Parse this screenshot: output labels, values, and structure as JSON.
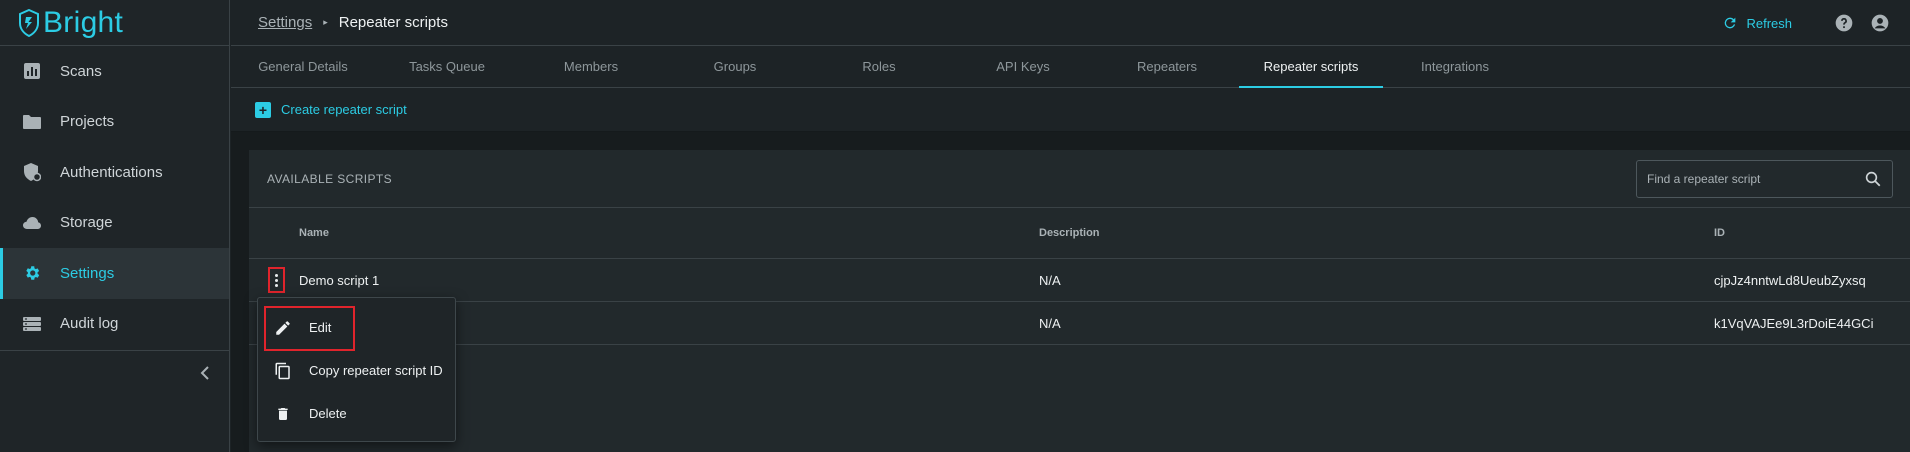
{
  "brand": {
    "name": "Bright",
    "accent": "#2ccce4",
    "highlight": "#e0242c"
  },
  "sidebar": {
    "items": [
      {
        "label": "Scans",
        "icon": "bar-chart-icon",
        "active": false
      },
      {
        "label": "Projects",
        "icon": "folder-icon",
        "active": false
      },
      {
        "label": "Authentications",
        "icon": "shield-lock-icon",
        "active": false
      },
      {
        "label": "Storage",
        "icon": "cloud-icon",
        "active": false
      },
      {
        "label": "Settings",
        "icon": "gear-icon",
        "active": true
      },
      {
        "label": "Audit log",
        "icon": "server-icon",
        "active": false
      }
    ]
  },
  "breadcrumb": {
    "parent": "Settings",
    "current": "Repeater scripts"
  },
  "header": {
    "refresh_label": "Refresh"
  },
  "tabs": [
    {
      "label": "General Details"
    },
    {
      "label": "Tasks Queue"
    },
    {
      "label": "Members"
    },
    {
      "label": "Groups"
    },
    {
      "label": "Roles"
    },
    {
      "label": "API Keys"
    },
    {
      "label": "Repeaters"
    },
    {
      "label": "Repeater scripts",
      "active": true
    },
    {
      "label": "Integrations"
    }
  ],
  "toolbar": {
    "create_label": "Create repeater script"
  },
  "panel": {
    "title": "AVAILABLE SCRIPTS",
    "search_placeholder": "Find a repeater script"
  },
  "table": {
    "columns": {
      "name": "Name",
      "description": "Description",
      "id": "ID"
    },
    "rows": [
      {
        "name": "Demo script 1",
        "description": "N/A",
        "id": "cjpJz4nntwLd8UeubZyxsq"
      },
      {
        "name": "",
        "description": "N/A",
        "id": "k1VqVAJEe9L3rDoiE44GCi"
      }
    ]
  },
  "context_menu": {
    "items": [
      {
        "label": "Edit",
        "icon": "pencil-icon"
      },
      {
        "label": "Copy repeater script ID",
        "icon": "copy-icon"
      },
      {
        "label": "Delete",
        "icon": "trash-icon"
      }
    ]
  }
}
